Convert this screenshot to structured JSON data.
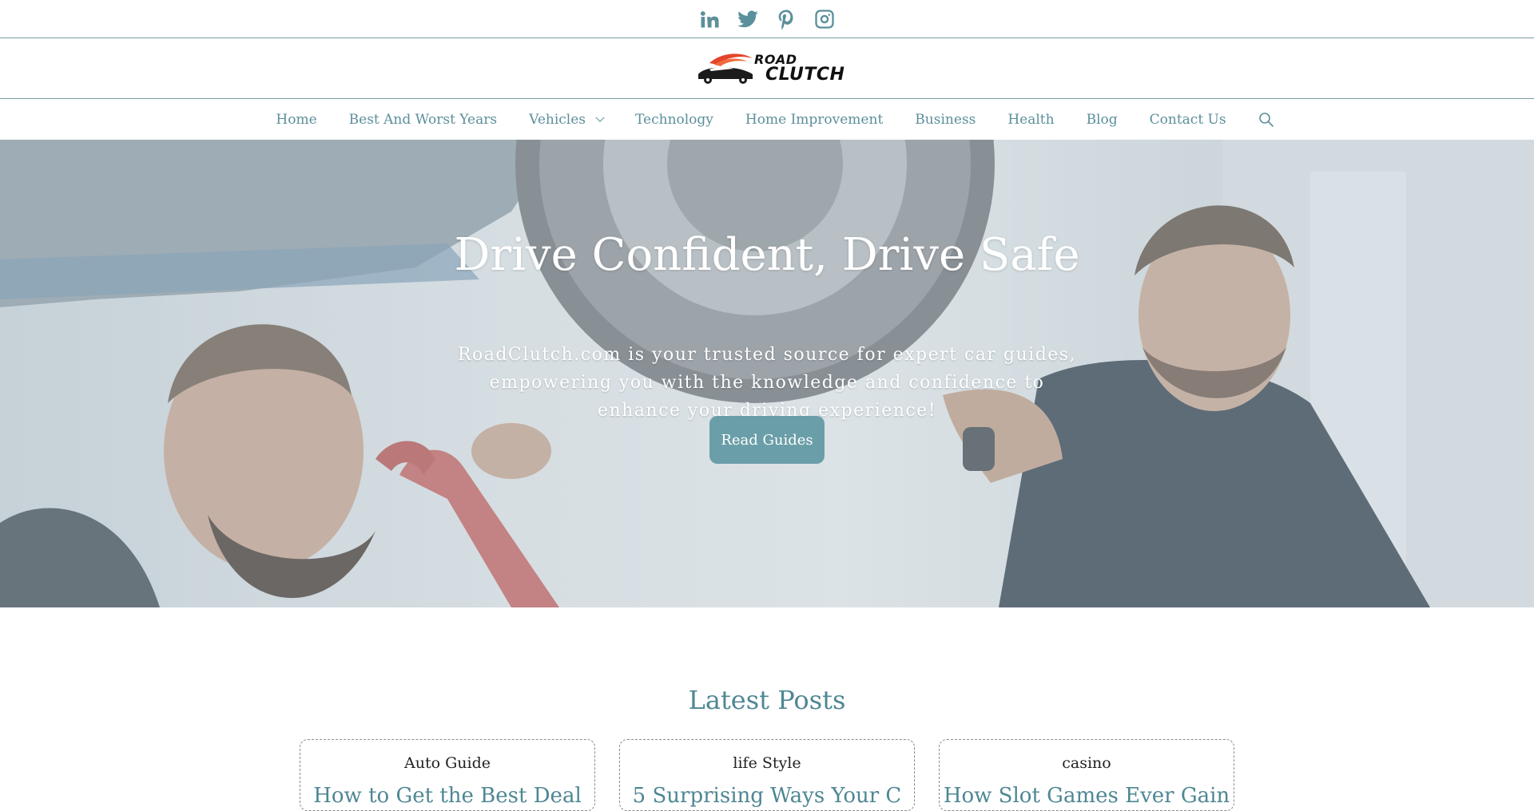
{
  "social": {
    "icons": [
      "linkedin-icon",
      "twitter-icon",
      "pinterest-icon",
      "instagram-icon"
    ]
  },
  "logo": {
    "line1": "ROAD",
    "line2": "CLUTCH"
  },
  "nav": {
    "items": [
      {
        "label": "Home"
      },
      {
        "label": "Best And Worst Years"
      },
      {
        "label": "Vehicles"
      },
      {
        "label": "Technology"
      },
      {
        "label": "Home Improvement"
      },
      {
        "label": "Business"
      },
      {
        "label": "Health"
      },
      {
        "label": "Blog"
      },
      {
        "label": "Contact Us"
      }
    ]
  },
  "hero": {
    "title": "Drive Confident, Drive Safe",
    "text": "RoadClutch.com is your trusted source for expert car guides, empowering you with the knowledge and confidence to enhance your driving experience!",
    "button": "Read Guides"
  },
  "latest": {
    "title": "Latest Posts",
    "posts": [
      {
        "category": "Auto Guide",
        "title": "How to Get the Best Deal"
      },
      {
        "category": "life Style",
        "title": "5 Surprising Ways Your C"
      },
      {
        "category": "casino",
        "title": "How Slot Games Ever Gain"
      }
    ]
  },
  "colors": {
    "accent": "#5b8f9b",
    "button": "#6a9ea8",
    "heading": "#4e8793"
  }
}
